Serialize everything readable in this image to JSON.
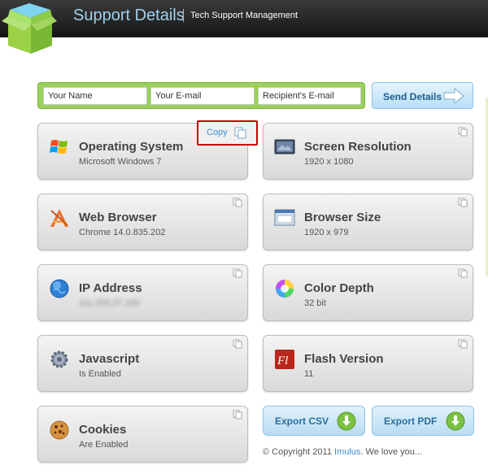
{
  "header": {
    "title": "Support Details",
    "subtitle": "Tech Support Management"
  },
  "form": {
    "name_placeholder": "Your Name",
    "email_placeholder": "Your E-mail",
    "recipient_placeholder": "Recipient's E-mail",
    "send_label": "Send Details"
  },
  "copy_label": "Copy",
  "cards": {
    "os": {
      "title": "Operating System",
      "value": "Microsoft Windows 7",
      "icon": "windows-icon"
    },
    "screen": {
      "title": "Screen Resolution",
      "value": "1920 x 1080",
      "icon": "monitor-icon"
    },
    "browser": {
      "title": "Web Browser",
      "value": "Chrome 14.0.835.202",
      "icon": "browser-app-icon"
    },
    "browser_size": {
      "title": "Browser Size",
      "value": "1920 x 979",
      "icon": "window-icon"
    },
    "ip": {
      "title": "IP Address",
      "value": "111.255.27.160",
      "icon": "globe-icon"
    },
    "color": {
      "title": "Color Depth",
      "value": "32 bit",
      "icon": "color-wheel-icon"
    },
    "js": {
      "title": "Javascript",
      "value": "Is Enabled",
      "icon": "gear-icon"
    },
    "flash": {
      "title": "Flash Version",
      "value": "11",
      "icon": "flash-icon"
    },
    "cookies": {
      "title": "Cookies",
      "value": "Are Enabled",
      "icon": "cookie-icon"
    }
  },
  "export": {
    "csv_label": "Export CSV",
    "pdf_label": "Export PDF"
  },
  "footer": {
    "prefix": "© Copyright 2011 ",
    "link": "Imulus",
    "suffix": ". We love you..."
  },
  "colors": {
    "header_bg": "#1f1f1f",
    "title": "#9fd0ee",
    "form_green": "#9bd05a",
    "button_blue": "#b8def6",
    "link_blue": "#3f8fd0",
    "highlight_red": "#cc0000"
  }
}
